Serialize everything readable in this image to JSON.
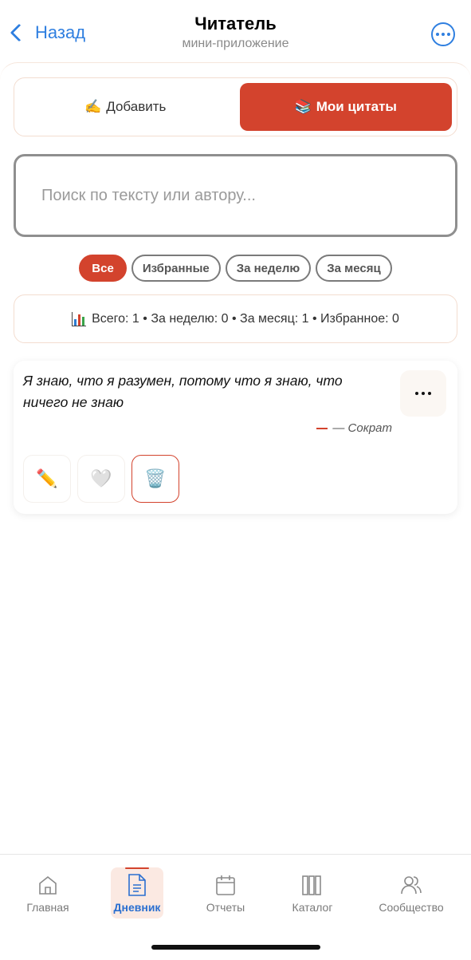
{
  "header": {
    "back_label": "Назад",
    "title": "Читатель",
    "subtitle": "мини-приложение"
  },
  "tabs": [
    {
      "emoji": "✍️",
      "label": "Добавить",
      "active": false
    },
    {
      "emoji": "📚",
      "label": "Мои цитаты",
      "active": true
    }
  ],
  "search": {
    "placeholder": "Поиск по тексту или автору...",
    "value": ""
  },
  "filters": [
    {
      "label": "Все",
      "active": true
    },
    {
      "label": "Избранные",
      "active": false
    },
    {
      "label": "За неделю",
      "active": false
    },
    {
      "label": "За месяц",
      "active": false
    }
  ],
  "stats": {
    "text": "Всего: 1 • За неделю: 0 • За месяц: 1 • Избранное: 0"
  },
  "quotes": [
    {
      "text": "Я знаю, что я разумен, потому что я знаю, что ничего не знаю",
      "author": "— Сократ",
      "actions": {
        "edit_icon": "✏️",
        "favorite_icon": "🤍",
        "delete_icon": "🗑️"
      }
    }
  ],
  "nav": [
    {
      "label": "Главная",
      "icon": "home-icon",
      "active": false
    },
    {
      "label": "Дневник",
      "icon": "document-icon",
      "active": true
    },
    {
      "label": "Отчеты",
      "icon": "calendar-icon",
      "active": false
    },
    {
      "label": "Каталог",
      "icon": "books-icon",
      "active": false
    },
    {
      "label": "Сообщество",
      "icon": "people-icon",
      "active": false
    }
  ],
  "colors": {
    "accent": "#d3432d",
    "link": "#2f7fe0",
    "nav_active": "#2a6fd0"
  }
}
